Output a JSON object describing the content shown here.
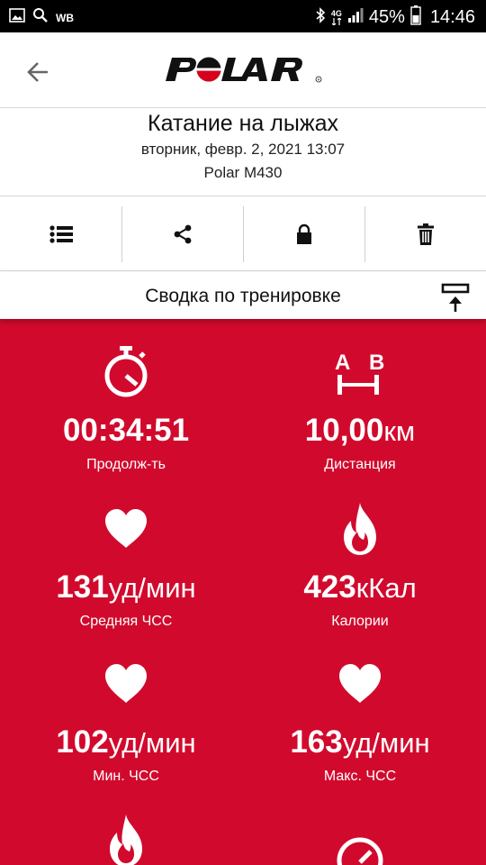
{
  "status_bar": {
    "carrier": "WB",
    "network": "4G",
    "battery": "45%",
    "time": "14:46"
  },
  "header": {
    "logo_text": "POLAR"
  },
  "session": {
    "sport": "Катание на лыжах",
    "datetime": "вторник, февр. 2, 2021 13:07",
    "device": "Polar M430"
  },
  "toolbar": {
    "items": [
      "list-icon",
      "share-icon",
      "lock-icon",
      "trash-icon"
    ]
  },
  "summary": {
    "title": "Сводка по тренировке"
  },
  "stats": [
    {
      "icon": "stopwatch-icon",
      "value": "00:34:51",
      "unit": "",
      "label": "Продолж-ть"
    },
    {
      "icon": "distance-ab-icon",
      "value": "10,00",
      "unit": "км",
      "label": "Дистанция"
    },
    {
      "icon": "heart-icon",
      "value": "131",
      "unit": "уд/мин",
      "label": "Средняя ЧСС"
    },
    {
      "icon": "flame-icon",
      "value": "423",
      "unit": "кКал",
      "label": "Калории"
    },
    {
      "icon": "heart-icon",
      "value": "102",
      "unit": "уд/мин",
      "label": "Мин. ЧСС"
    },
    {
      "icon": "heart-icon",
      "value": "163",
      "unit": "уд/мин",
      "label": "Макс. ЧСС"
    }
  ],
  "colors": {
    "brand_red": "#d10a2d",
    "logo_red": "#d6001c"
  }
}
